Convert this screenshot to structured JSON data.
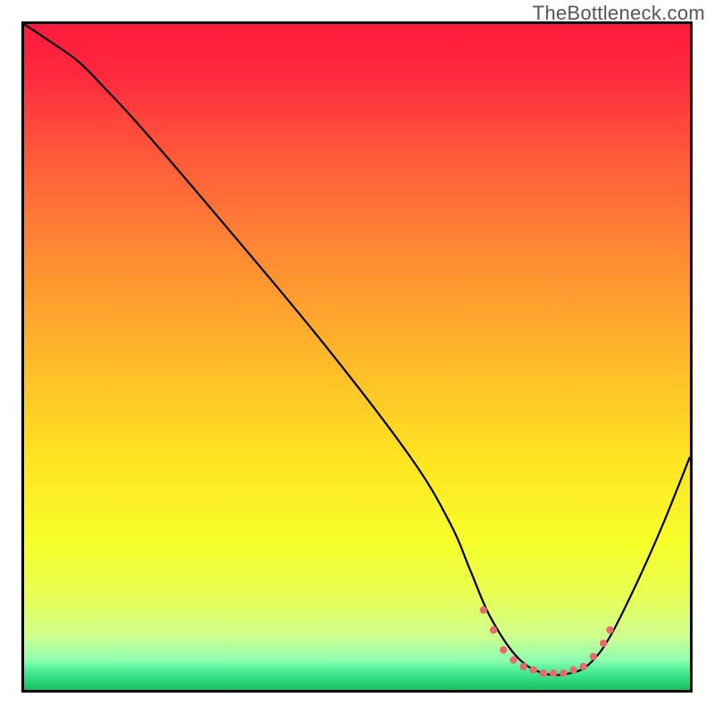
{
  "watermark": "TheBottleneck.com",
  "chart_data": {
    "type": "line",
    "title": "",
    "xlabel": "",
    "ylabel": "",
    "xlim": [
      0,
      100
    ],
    "ylim": [
      0,
      100
    ],
    "background_gradient": {
      "stops": [
        {
          "offset": 0.0,
          "color": "#ff1a3d"
        },
        {
          "offset": 0.08,
          "color": "#ff2a3e"
        },
        {
          "offset": 0.2,
          "color": "#ff5a3a"
        },
        {
          "offset": 0.35,
          "color": "#ff8b33"
        },
        {
          "offset": 0.5,
          "color": "#ffb82a"
        },
        {
          "offset": 0.65,
          "color": "#ffe322"
        },
        {
          "offset": 0.78,
          "color": "#f6ff2a"
        },
        {
          "offset": 0.86,
          "color": "#e8ff55"
        },
        {
          "offset": 0.92,
          "color": "#cfff90"
        },
        {
          "offset": 0.955,
          "color": "#8dffb0"
        },
        {
          "offset": 0.975,
          "color": "#40e890"
        },
        {
          "offset": 1.0,
          "color": "#18c060"
        }
      ]
    },
    "series": [
      {
        "name": "bottleneck-curve",
        "color": "#000000",
        "x": [
          0.0,
          3.0,
          8.0,
          12.0,
          18.0,
          30.0,
          45.0,
          58.0,
          64.0,
          67.0,
          70.0,
          74.0,
          78.0,
          82.0,
          85.0,
          88.0,
          92.0,
          96.0,
          100.0
        ],
        "y": [
          100.0,
          98.0,
          94.5,
          90.5,
          84.0,
          70.0,
          52.0,
          35.0,
          25.0,
          18.0,
          11.0,
          5.0,
          2.5,
          2.5,
          4.0,
          8.0,
          16.0,
          25.0,
          35.0
        ]
      }
    ],
    "markers": {
      "name": "optimum-band",
      "color": "#e86a6a",
      "x": [
        69.0,
        70.5,
        72.0,
        73.5,
        75.0,
        76.5,
        78.0,
        79.5,
        81.0,
        82.5,
        84.0,
        85.5,
        87.0,
        88.0
      ],
      "y": [
        12.0,
        9.0,
        6.0,
        4.5,
        3.5,
        3.0,
        2.5,
        2.5,
        2.5,
        3.0,
        3.5,
        5.0,
        7.0,
        9.0
      ]
    }
  }
}
